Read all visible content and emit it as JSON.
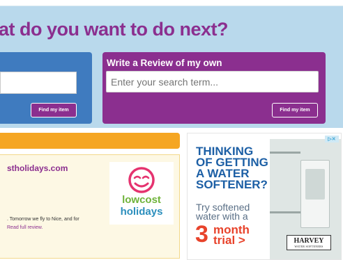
{
  "hero": {
    "title": "at do you want to do next?"
  },
  "left_panel": {
    "button_label": "Find my item"
  },
  "right_panel": {
    "heading": "Write a Review of my own",
    "search_placeholder": "Enter your search term...",
    "button_label": "Find my item"
  },
  "review_card": {
    "site": "stholidays.com",
    "text": ". Tomorrow we fly to Nice, and for",
    "read_more": "Read full review.",
    "logo": {
      "word1": "lowcost",
      "word2": "holidays"
    }
  },
  "ad": {
    "headline_1": "THINKING",
    "headline_2": "OF GETTING",
    "headline_3": "A WATER",
    "headline_4": "SOFTENER?",
    "sub_1": "Try softened",
    "sub_2": "water with a",
    "number": "3",
    "trial_1": "month",
    "trial_2": "trial >",
    "brand": "HARVEY",
    "brand_tag": "WATER SOFTENERS",
    "adchoices": "▷✕"
  },
  "colors": {
    "hero_bg": "#b9d9ec",
    "brand_purple": "#8b2f8f",
    "panel_blue": "#3f7bbf",
    "orange": "#f5a623",
    "ad_blue": "#1c5fa5",
    "ad_red": "#e8432b"
  }
}
